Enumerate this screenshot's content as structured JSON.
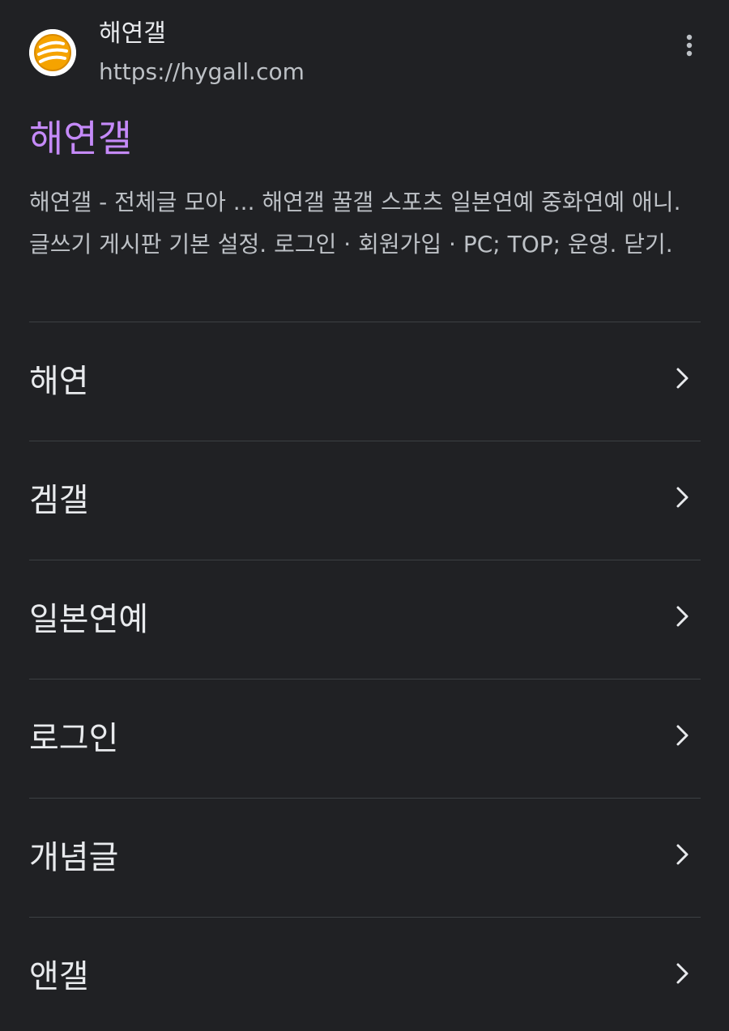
{
  "site": {
    "name": "해연갤",
    "url": "https://hygall.com",
    "favicon_icon": "hygall-logo-icon",
    "more_icon": "more-vert-icon"
  },
  "result": {
    "title": "해연갤",
    "snippet": "해연갤 - 전체글 모아 ... 해연갤 꿀갤 스포츠 일본연예 중화연예 애니. 글쓰기 게시판 기본 설정. 로그인 · 회원가입 · PC; TOP; 운영. 닫기."
  },
  "sitelinks": [
    {
      "label": "해연"
    },
    {
      "label": "겜갤"
    },
    {
      "label": "일본연예"
    },
    {
      "label": "로그인"
    },
    {
      "label": "개념글"
    },
    {
      "label": "앤갤"
    }
  ],
  "colors": {
    "background": "#202124",
    "title": "#c58af9",
    "text": "#e8eaed",
    "secondary_text": "#bdc1c6",
    "divider": "#3c4043",
    "logo_orange": "#f5a300"
  }
}
